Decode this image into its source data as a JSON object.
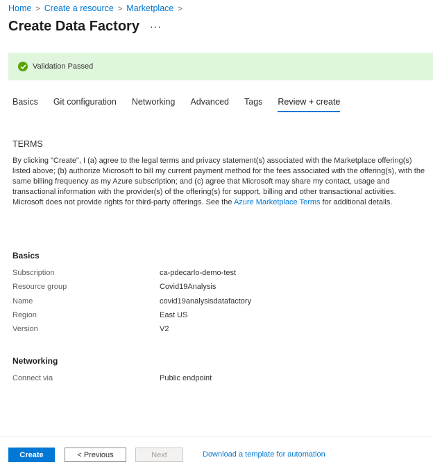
{
  "breadcrumb": [
    "Home",
    "Create a resource",
    "Marketplace"
  ],
  "page": {
    "title": "Create Data Factory",
    "more": "···"
  },
  "validation": {
    "message": "Validation Passed",
    "color": "#57a300"
  },
  "tabs": [
    {
      "label": "Basics"
    },
    {
      "label": "Git configuration"
    },
    {
      "label": "Networking"
    },
    {
      "label": "Advanced"
    },
    {
      "label": "Tags"
    },
    {
      "label": "Review + create"
    }
  ],
  "terms": {
    "heading": "TERMS",
    "text_before": "By clicking \"Create\", I (a) agree to the legal terms and privacy statement(s) associated with the Marketplace offering(s) listed above; (b) authorize Microsoft to bill my current payment method for the fees associated with the offering(s), with the same billing frequency as my Azure subscription; and (c) agree that Microsoft may share my contact, usage and transactional information with the provider(s) of the offering(s) for support, billing and other transactional activities. Microsoft does not provide rights for third-party offerings. See the ",
    "link": "Azure Marketplace Terms",
    "text_after": " for additional details."
  },
  "basics": {
    "heading": "Basics",
    "rows": [
      {
        "label": "Subscription",
        "value": "ca-pdecarlo-demo-test"
      },
      {
        "label": "Resource group",
        "value": "Covid19Analysis"
      },
      {
        "label": "Name",
        "value": "covid19analysisdatafactory"
      },
      {
        "label": "Region",
        "value": "East US"
      },
      {
        "label": "Version",
        "value": "V2"
      }
    ]
  },
  "networking": {
    "heading": "Networking",
    "rows": [
      {
        "label": "Connect via",
        "value": "Public endpoint"
      }
    ]
  },
  "footer": {
    "create": "Create",
    "previous": "< Previous",
    "next": "Next",
    "download": "Download a template for automation"
  }
}
